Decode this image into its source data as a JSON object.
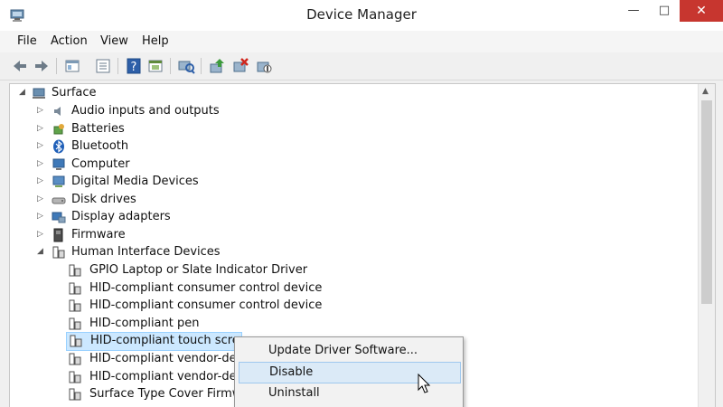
{
  "window": {
    "title": "Device Manager",
    "controls": {
      "minimize": "—",
      "maximize": "□",
      "close": "✕"
    }
  },
  "menu": [
    "File",
    "Action",
    "View",
    "Help"
  ],
  "toolbar": [
    "back-arrow-icon",
    "forward-arrow-icon",
    "properties-icon",
    "view-icon",
    "help-icon",
    "show-hidden-icon",
    "scan-hardware-icon",
    "update-driver-icon",
    "uninstall-icon",
    "disable-device-icon"
  ],
  "tree": {
    "root": "Surface",
    "categories": [
      "Audio inputs and outputs",
      "Batteries",
      "Bluetooth",
      "Computer",
      "Digital Media Devices",
      "Disk drives",
      "Display adapters",
      "Firmware",
      "Human Interface Devices"
    ],
    "hid_devices": [
      "GPIO Laptop or Slate Indicator Driver",
      "HID-compliant consumer control device",
      "HID-compliant consumer control device",
      "HID-compliant pen",
      "HID-compliant touch screen",
      "HID-compliant vendor-defined device",
      "HID-compliant vendor-defined device",
      "Surface Type Cover Firmware Update"
    ]
  },
  "context_menu": [
    "Update Driver Software...",
    "Disable",
    "Uninstall"
  ]
}
